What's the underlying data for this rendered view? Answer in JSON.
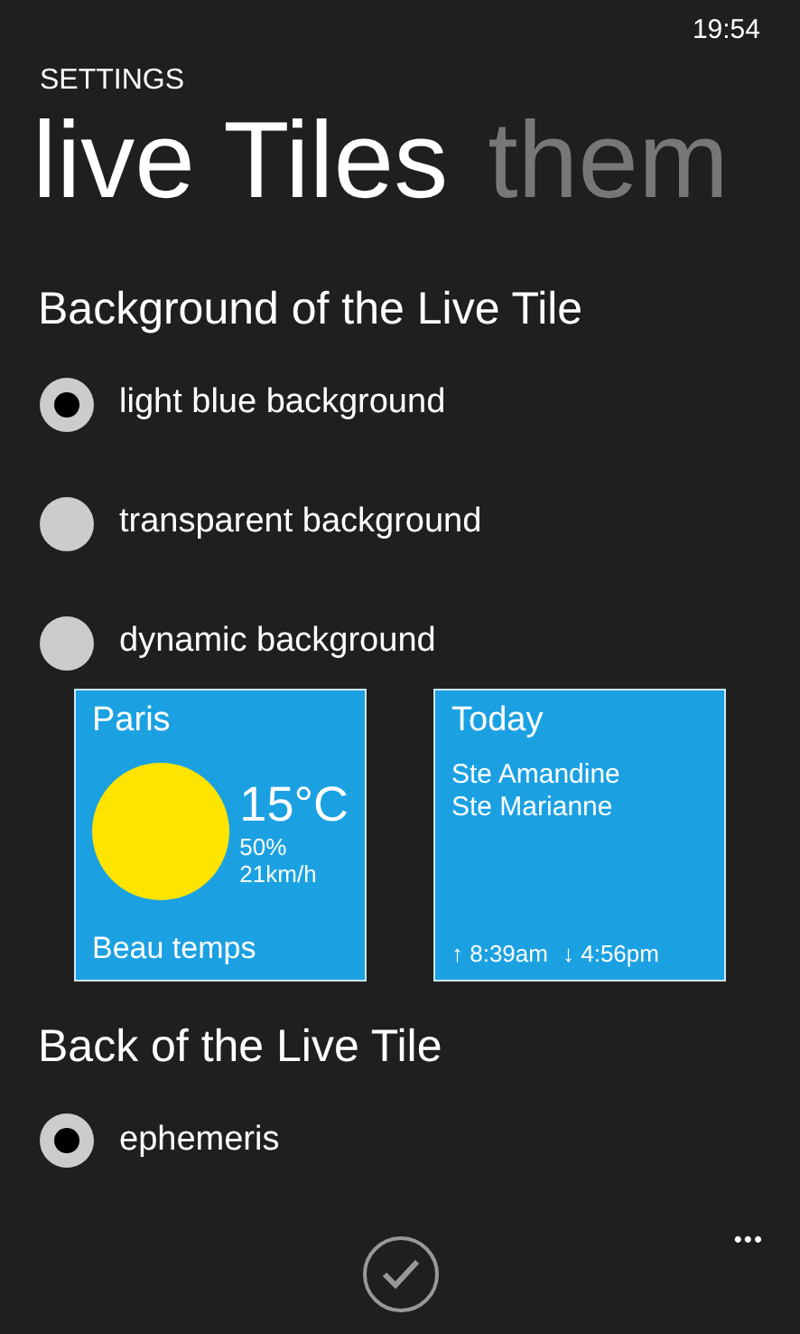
{
  "status_bar": {
    "time": "19:54"
  },
  "app_title": "SETTINGS",
  "pivot": [
    {
      "label": "live Tiles",
      "selected": true
    },
    {
      "label": "them",
      "selected": false
    }
  ],
  "sections": [
    {
      "title": "Background of the Live Tile",
      "options": [
        {
          "label": "light blue background",
          "selected": true
        },
        {
          "label": "transparent background",
          "selected": false
        },
        {
          "label": "dynamic background",
          "selected": false
        }
      ]
    },
    {
      "kind": "tiles",
      "tiles": [
        {
          "kind": "weather",
          "city": "Paris",
          "temperature": "15°C",
          "humidity": "50%",
          "wind": "21km/h",
          "condition": "Beau temps"
        },
        {
          "kind": "day",
          "title": "Today",
          "names": [
            "Ste Amandine",
            "Ste Marianne"
          ],
          "sunrise": "↑ 8:39am",
          "sunset": "↓ 4:56pm"
        }
      ]
    },
    {
      "title": "Back of the Live Tile",
      "options": [
        {
          "label": "ephemeris",
          "selected": true
        }
      ]
    }
  ],
  "app_bar": {
    "more": "•••"
  }
}
